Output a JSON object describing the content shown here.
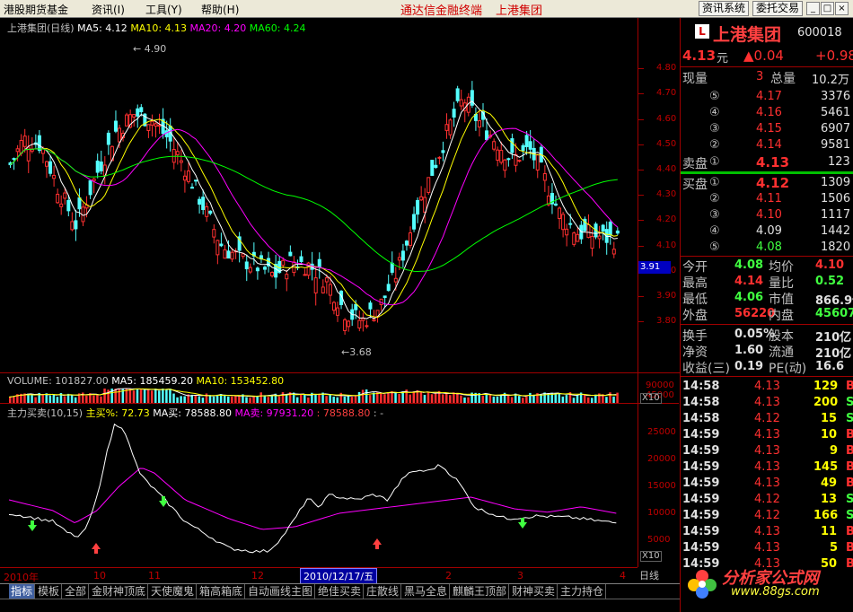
{
  "menu": {
    "items": [
      "港股期货基金",
      "资讯(I)",
      "工具(Y)",
      "帮助(H)"
    ],
    "center_title": "通达信金融终端",
    "center_stock": "上港集团",
    "btn_info": "资讯系统",
    "btn_trade": "委托交易",
    "win_min": "_",
    "win_max": "□",
    "win_close": "×"
  },
  "main_chart": {
    "title": "上港集团(日线)",
    "ma5": "MA5: 4.12",
    "ma10": "MA10: 4.13",
    "ma20": "MA20: 4.20",
    "ma60": "MA60: 4.24",
    "high_label": "4.90",
    "low_label": "3.68",
    "current_price_tag": "3.91",
    "y_ticks": [
      "4.80",
      "4.70",
      "4.60",
      "4.50",
      "4.40",
      "4.30",
      "4.20",
      "4.10",
      "4.00",
      "3.90",
      "3.80"
    ],
    "ylim": [
      3.68,
      4.9
    ]
  },
  "volume_chart": {
    "volume": "VOLUME: 101827.00",
    "ma5": "MA5: 185459.20",
    "ma10": "MA10: 153452.80",
    "y_ticks": [
      "90000",
      "45000"
    ],
    "unit": "X10"
  },
  "indicator_chart": {
    "title": "主力买卖(10,15)",
    "buy_pct": "主买%: 72.73",
    "ma_buy": "MA买: 78588.80",
    "ma_sell": "MA卖: 97931.20",
    "diff": ": 78588.80",
    "tail": ": -",
    "y_ticks": [
      "25000",
      "20000",
      "15000",
      "10000",
      "5000"
    ],
    "unit": "X10"
  },
  "time_axis": {
    "labels": [
      "2010年",
      "10",
      "11",
      "12",
      "2",
      "3",
      "4"
    ],
    "selected_date": "2010/12/17/五",
    "period": "日线"
  },
  "quote": {
    "name": "上港集团",
    "code": "600018",
    "price": "4.13",
    "price_unit": "元",
    "change": "▲0.04",
    "change_pct": "+0.98",
    "xianliang_label": "现量",
    "xianliang_val": "3",
    "zongliang_label": "总量",
    "zongliang_val": "10.2万",
    "sell_levels": [
      {
        "n": "⑤",
        "p": "4.17",
        "v": "3376"
      },
      {
        "n": "④",
        "p": "4.16",
        "v": "5461"
      },
      {
        "n": "③",
        "p": "4.15",
        "v": "6907"
      },
      {
        "n": "②",
        "p": "4.14",
        "v": "9581"
      }
    ],
    "sell1_label": "卖盘",
    "sell1": {
      "n": "①",
      "p": "4.13",
      "v": "123"
    },
    "buy1_label": "买盘",
    "buy1": {
      "n": "①",
      "p": "4.12",
      "v": "1309"
    },
    "buy_levels": [
      {
        "n": "②",
        "p": "4.11",
        "v": "1506"
      },
      {
        "n": "③",
        "p": "4.10",
        "v": "1117"
      },
      {
        "n": "④",
        "p": "4.09",
        "v": "1442"
      },
      {
        "n": "⑤",
        "p": "4.08",
        "v": "1820"
      }
    ],
    "stats": [
      {
        "l1": "今开",
        "v1": "4.08",
        "l2": "均价",
        "v2": "4.10"
      },
      {
        "l1": "最高",
        "v1": "4.14",
        "l2": "量比",
        "v2": "0.52"
      },
      {
        "l1": "最低",
        "v1": "4.06",
        "l2": "市值",
        "v2": "866.9亿"
      },
      {
        "l1": "外盘",
        "v1": "56220",
        "l2": "内盘",
        "v2": "45607"
      }
    ],
    "fin": [
      {
        "l1": "换手",
        "v1": "0.05%",
        "l2": "股本",
        "v2": "210亿"
      },
      {
        "l1": "净资",
        "v1": "1.60",
        "l2": "流通",
        "v2": "210亿"
      },
      {
        "l1": "收益(三)",
        "v1": "0.19",
        "l2": "PE(动)",
        "v2": "16.6"
      }
    ],
    "ticks": [
      {
        "t": "14:58",
        "p": "4.13",
        "v": "129",
        "d": "B"
      },
      {
        "t": "14:58",
        "p": "4.13",
        "v": "200",
        "d": "S"
      },
      {
        "t": "14:58",
        "p": "4.12",
        "v": "15",
        "d": "S"
      },
      {
        "t": "14:59",
        "p": "4.13",
        "v": "10",
        "d": "B"
      },
      {
        "t": "14:59",
        "p": "4.13",
        "v": "9",
        "d": "B"
      },
      {
        "t": "14:59",
        "p": "4.13",
        "v": "145",
        "d": "B"
      },
      {
        "t": "14:59",
        "p": "4.13",
        "v": "49",
        "d": "B"
      },
      {
        "t": "14:59",
        "p": "4.12",
        "v": "13",
        "d": "S"
      },
      {
        "t": "14:59",
        "p": "4.12",
        "v": "166",
        "d": "S"
      },
      {
        "t": "14:59",
        "p": "4.13",
        "v": "11",
        "d": "B"
      },
      {
        "t": "14:59",
        "p": "4.13",
        "v": "5",
        "d": "B"
      },
      {
        "t": "14:59",
        "p": "4.13",
        "v": "50",
        "d": "B"
      }
    ]
  },
  "tabs": [
    "指标",
    "模板",
    "全部",
    "金财神顶底",
    "天使魔鬼",
    "箱高箱底",
    "自动画线主图",
    "绝佳买卖",
    "庄散线",
    "黑马全息",
    "麒麟王顶部",
    "财神买卖",
    "主力持仓"
  ],
  "logo": {
    "name": "分析家公式网",
    "url": "www.88gs.com"
  },
  "colors": {
    "up": "#ff3030",
    "down": "#00ffff",
    "ma5": "#ffffff",
    "ma10": "#ffff00",
    "ma20": "#ff00ff",
    "ma60": "#00ff00",
    "grid": "#a00000"
  }
}
